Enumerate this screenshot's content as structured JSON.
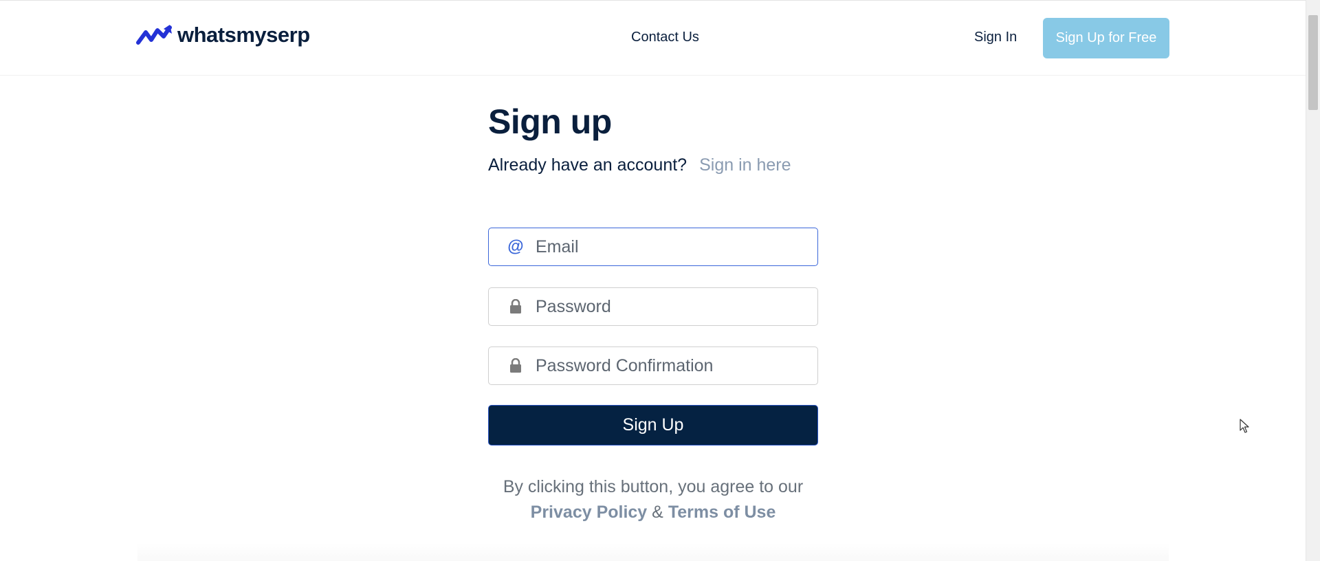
{
  "header": {
    "logo_text": "whatsmyserp",
    "contact_label": "Contact Us",
    "signin_label": "Sign In",
    "signup_label": "Sign Up for Free"
  },
  "form": {
    "title": "Sign up",
    "already_text": "Already have an account?",
    "signin_link": "Sign in here",
    "email_placeholder": "Email",
    "password_placeholder": "Password",
    "password_confirm_placeholder": "Password Confirmation",
    "submit_label": "Sign Up",
    "terms_text": "By clicking this button, you agree to our",
    "privacy_label": "Privacy Policy",
    "amp": "&",
    "terms_label": "Terms of Use"
  },
  "icons": {
    "email": "at-icon",
    "password": "lock-icon",
    "logo": "trend-arrow-icon"
  },
  "colors": {
    "brand_navy": "#052242",
    "cta_light": "#88c9e6",
    "focus_blue": "#3a66d9",
    "link_muted": "#8a9bb1"
  }
}
